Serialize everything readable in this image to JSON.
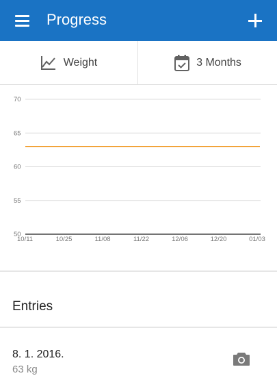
{
  "app_bar": {
    "title": "Progress",
    "menu_icon": "menu-icon",
    "add_icon": "add-icon",
    "background_color": "#1a73c4"
  },
  "filters": {
    "metric": {
      "label": "Weight",
      "icon": "line-chart-icon"
    },
    "range": {
      "label": "3 Months",
      "icon": "calendar-check-icon"
    }
  },
  "chart_data": {
    "type": "line",
    "title": "",
    "xlabel": "",
    "ylabel": "",
    "ylim": [
      50,
      70
    ],
    "y_ticks": [
      "50",
      "55",
      "60",
      "65",
      "70"
    ],
    "x_ticks": [
      "10/11",
      "10/25",
      "11/08",
      "11/22",
      "12/06",
      "12/20",
      "01/03"
    ],
    "grid": true,
    "series": [
      {
        "color": "#f2a43a",
        "x": [
          "10/11",
          "01/03"
        ],
        "values": [
          63,
          63
        ]
      }
    ]
  },
  "entries_section": {
    "title": "Entries"
  },
  "entries": [
    {
      "date": "8. 1. 2016.",
      "value": "63 kg",
      "icon": "camera-icon"
    }
  ]
}
